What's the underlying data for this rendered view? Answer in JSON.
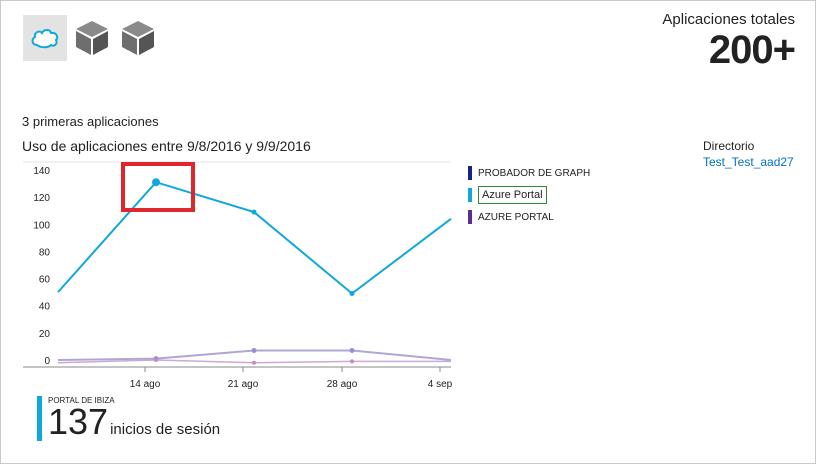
{
  "apps": [
    {
      "icon": "salesforce-cloud-icon",
      "selected": true
    },
    {
      "icon": "app-box-icon",
      "selected": false
    },
    {
      "icon": "app-box-icon",
      "selected": false
    }
  ],
  "totals": {
    "label": "Aplicaciones totales",
    "value": "200+"
  },
  "top_apps_title": "3 primeras aplicaciones",
  "usage_title": "Uso de aplicaciones entre 9/8/2016 y 9/9/2016",
  "directory": {
    "label": "Directorio",
    "value": "Test_Test_aad27"
  },
  "colors": {
    "azure_portal": "#0fa8dc",
    "probador_graph": "#1a237e",
    "azure_portal_caps": "#5c2d91",
    "highlight": "#e0262d"
  },
  "chart_data": {
    "type": "line",
    "x_ticks": [
      "14 ago",
      "21 ago",
      "28 ago",
      "4 sep"
    ],
    "y_ticks": [
      0,
      20,
      40,
      60,
      80,
      100,
      120,
      140
    ],
    "ylim": [
      0,
      140
    ],
    "x": [
      "9 ago",
      "16 ago",
      "23 ago",
      "30 ago",
      "6 sep"
    ],
    "series": [
      {
        "name": "PROBADOR DE GRAPH",
        "color": "#1a237e",
        "values": [
          0,
          1,
          7,
          7,
          0
        ]
      },
      {
        "name": "Azure Portal",
        "color": "#0fa8dc",
        "values": [
          50,
          131,
          109,
          49,
          104
        ]
      },
      {
        "name": "AZURE PORTAL",
        "color": "#5c2d91",
        "values": [
          -2,
          0,
          -2,
          -1,
          -1
        ]
      }
    ],
    "legend": "right",
    "active_series": "Azure Portal"
  },
  "ibiza": {
    "label": "PORTAL DE IBIZA",
    "value": "137",
    "unit": "inicios de sesión"
  }
}
